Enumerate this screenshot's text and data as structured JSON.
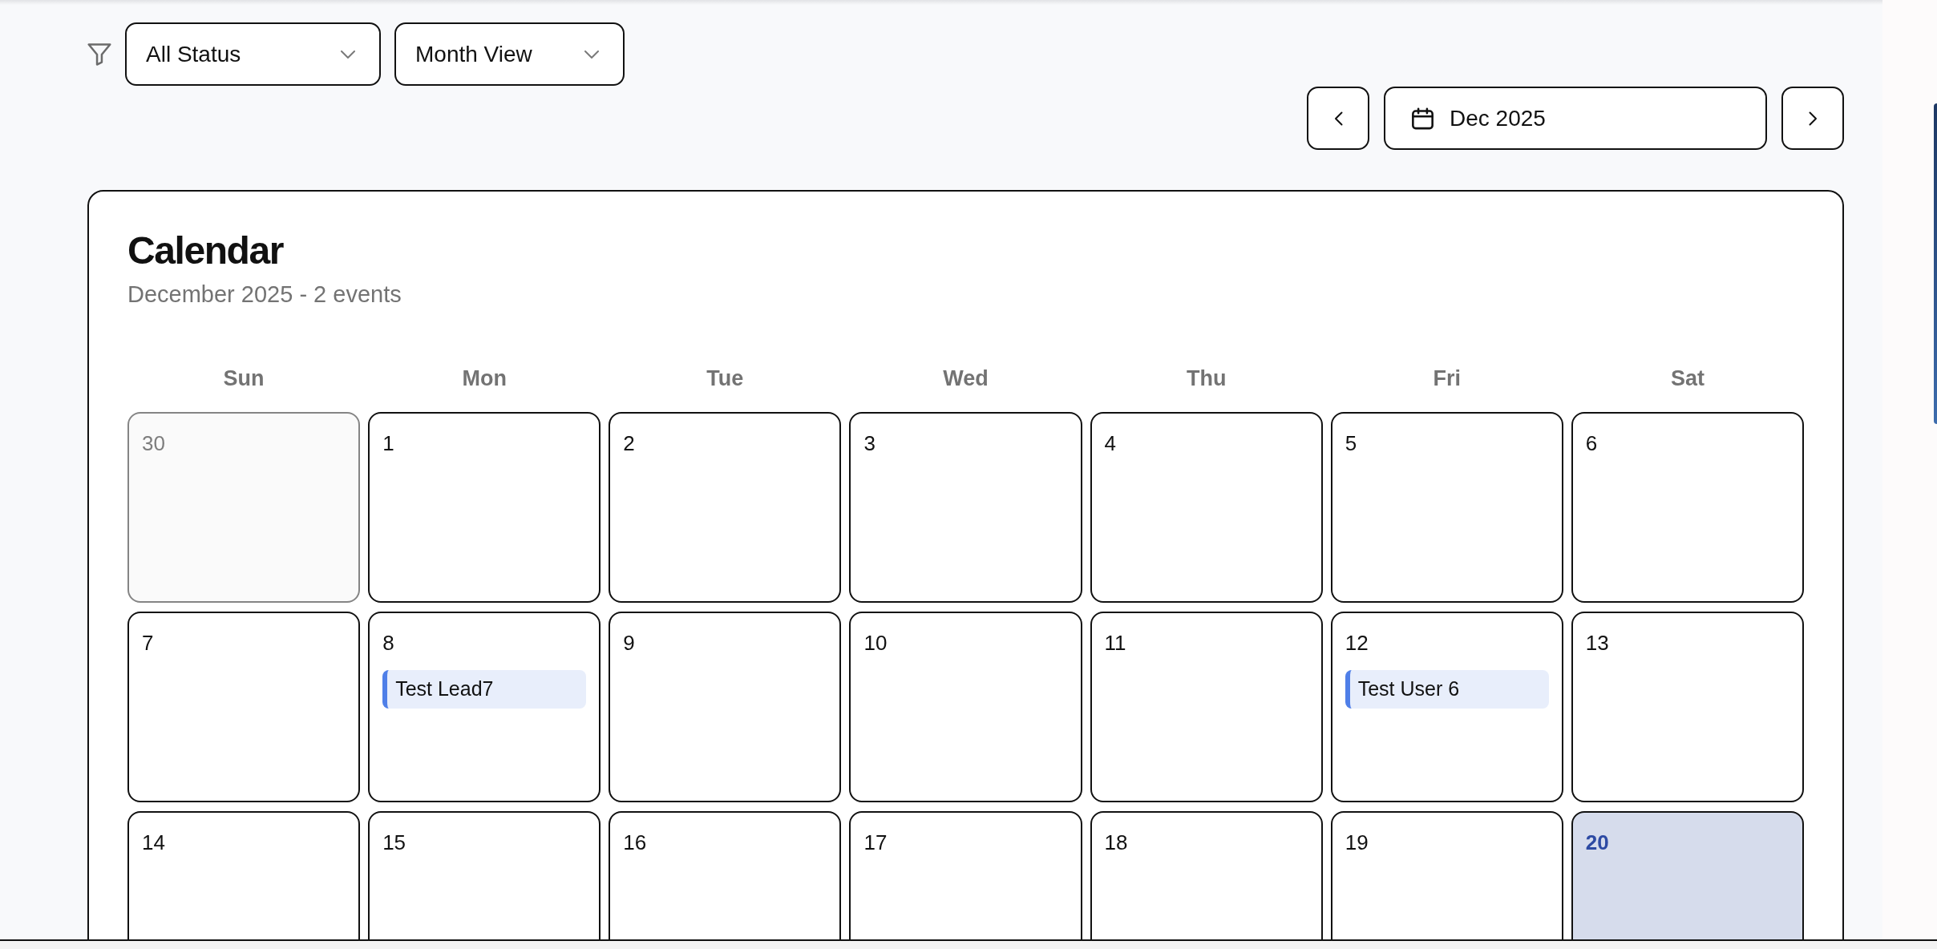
{
  "filters": {
    "status": {
      "value": "All Status"
    },
    "view": {
      "value": "Month View"
    }
  },
  "navigation": {
    "period": "Dec 2025"
  },
  "calendar": {
    "title": "Calendar",
    "subtitle": "December 2025 - 2 events",
    "weekdays": [
      "Sun",
      "Mon",
      "Tue",
      "Wed",
      "Thu",
      "Fri",
      "Sat"
    ],
    "weeks": [
      [
        {
          "day": "30",
          "outside_month": true,
          "today": false
        },
        {
          "day": "1",
          "outside_month": false,
          "today": false
        },
        {
          "day": "2",
          "outside_month": false,
          "today": false
        },
        {
          "day": "3",
          "outside_month": false,
          "today": false
        },
        {
          "day": "4",
          "outside_month": false,
          "today": false
        },
        {
          "day": "5",
          "outside_month": false,
          "today": false
        },
        {
          "day": "6",
          "outside_month": false,
          "today": false
        }
      ],
      [
        {
          "day": "7",
          "outside_month": false,
          "today": false
        },
        {
          "day": "8",
          "outside_month": false,
          "today": false,
          "events": [
            {
              "title": "Test Lead7"
            }
          ]
        },
        {
          "day": "9",
          "outside_month": false,
          "today": false
        },
        {
          "day": "10",
          "outside_month": false,
          "today": false
        },
        {
          "day": "11",
          "outside_month": false,
          "today": false
        },
        {
          "day": "12",
          "outside_month": false,
          "today": false,
          "events": [
            {
              "title": "Test User 6"
            }
          ]
        },
        {
          "day": "13",
          "outside_month": false,
          "today": false
        }
      ],
      [
        {
          "day": "14",
          "outside_month": false,
          "today": false
        },
        {
          "day": "15",
          "outside_month": false,
          "today": false
        },
        {
          "day": "16",
          "outside_month": false,
          "today": false
        },
        {
          "day": "17",
          "outside_month": false,
          "today": false
        },
        {
          "day": "18",
          "outside_month": false,
          "today": false
        },
        {
          "day": "19",
          "outside_month": false,
          "today": false
        },
        {
          "day": "20",
          "outside_month": false,
          "today": true
        }
      ]
    ]
  }
}
